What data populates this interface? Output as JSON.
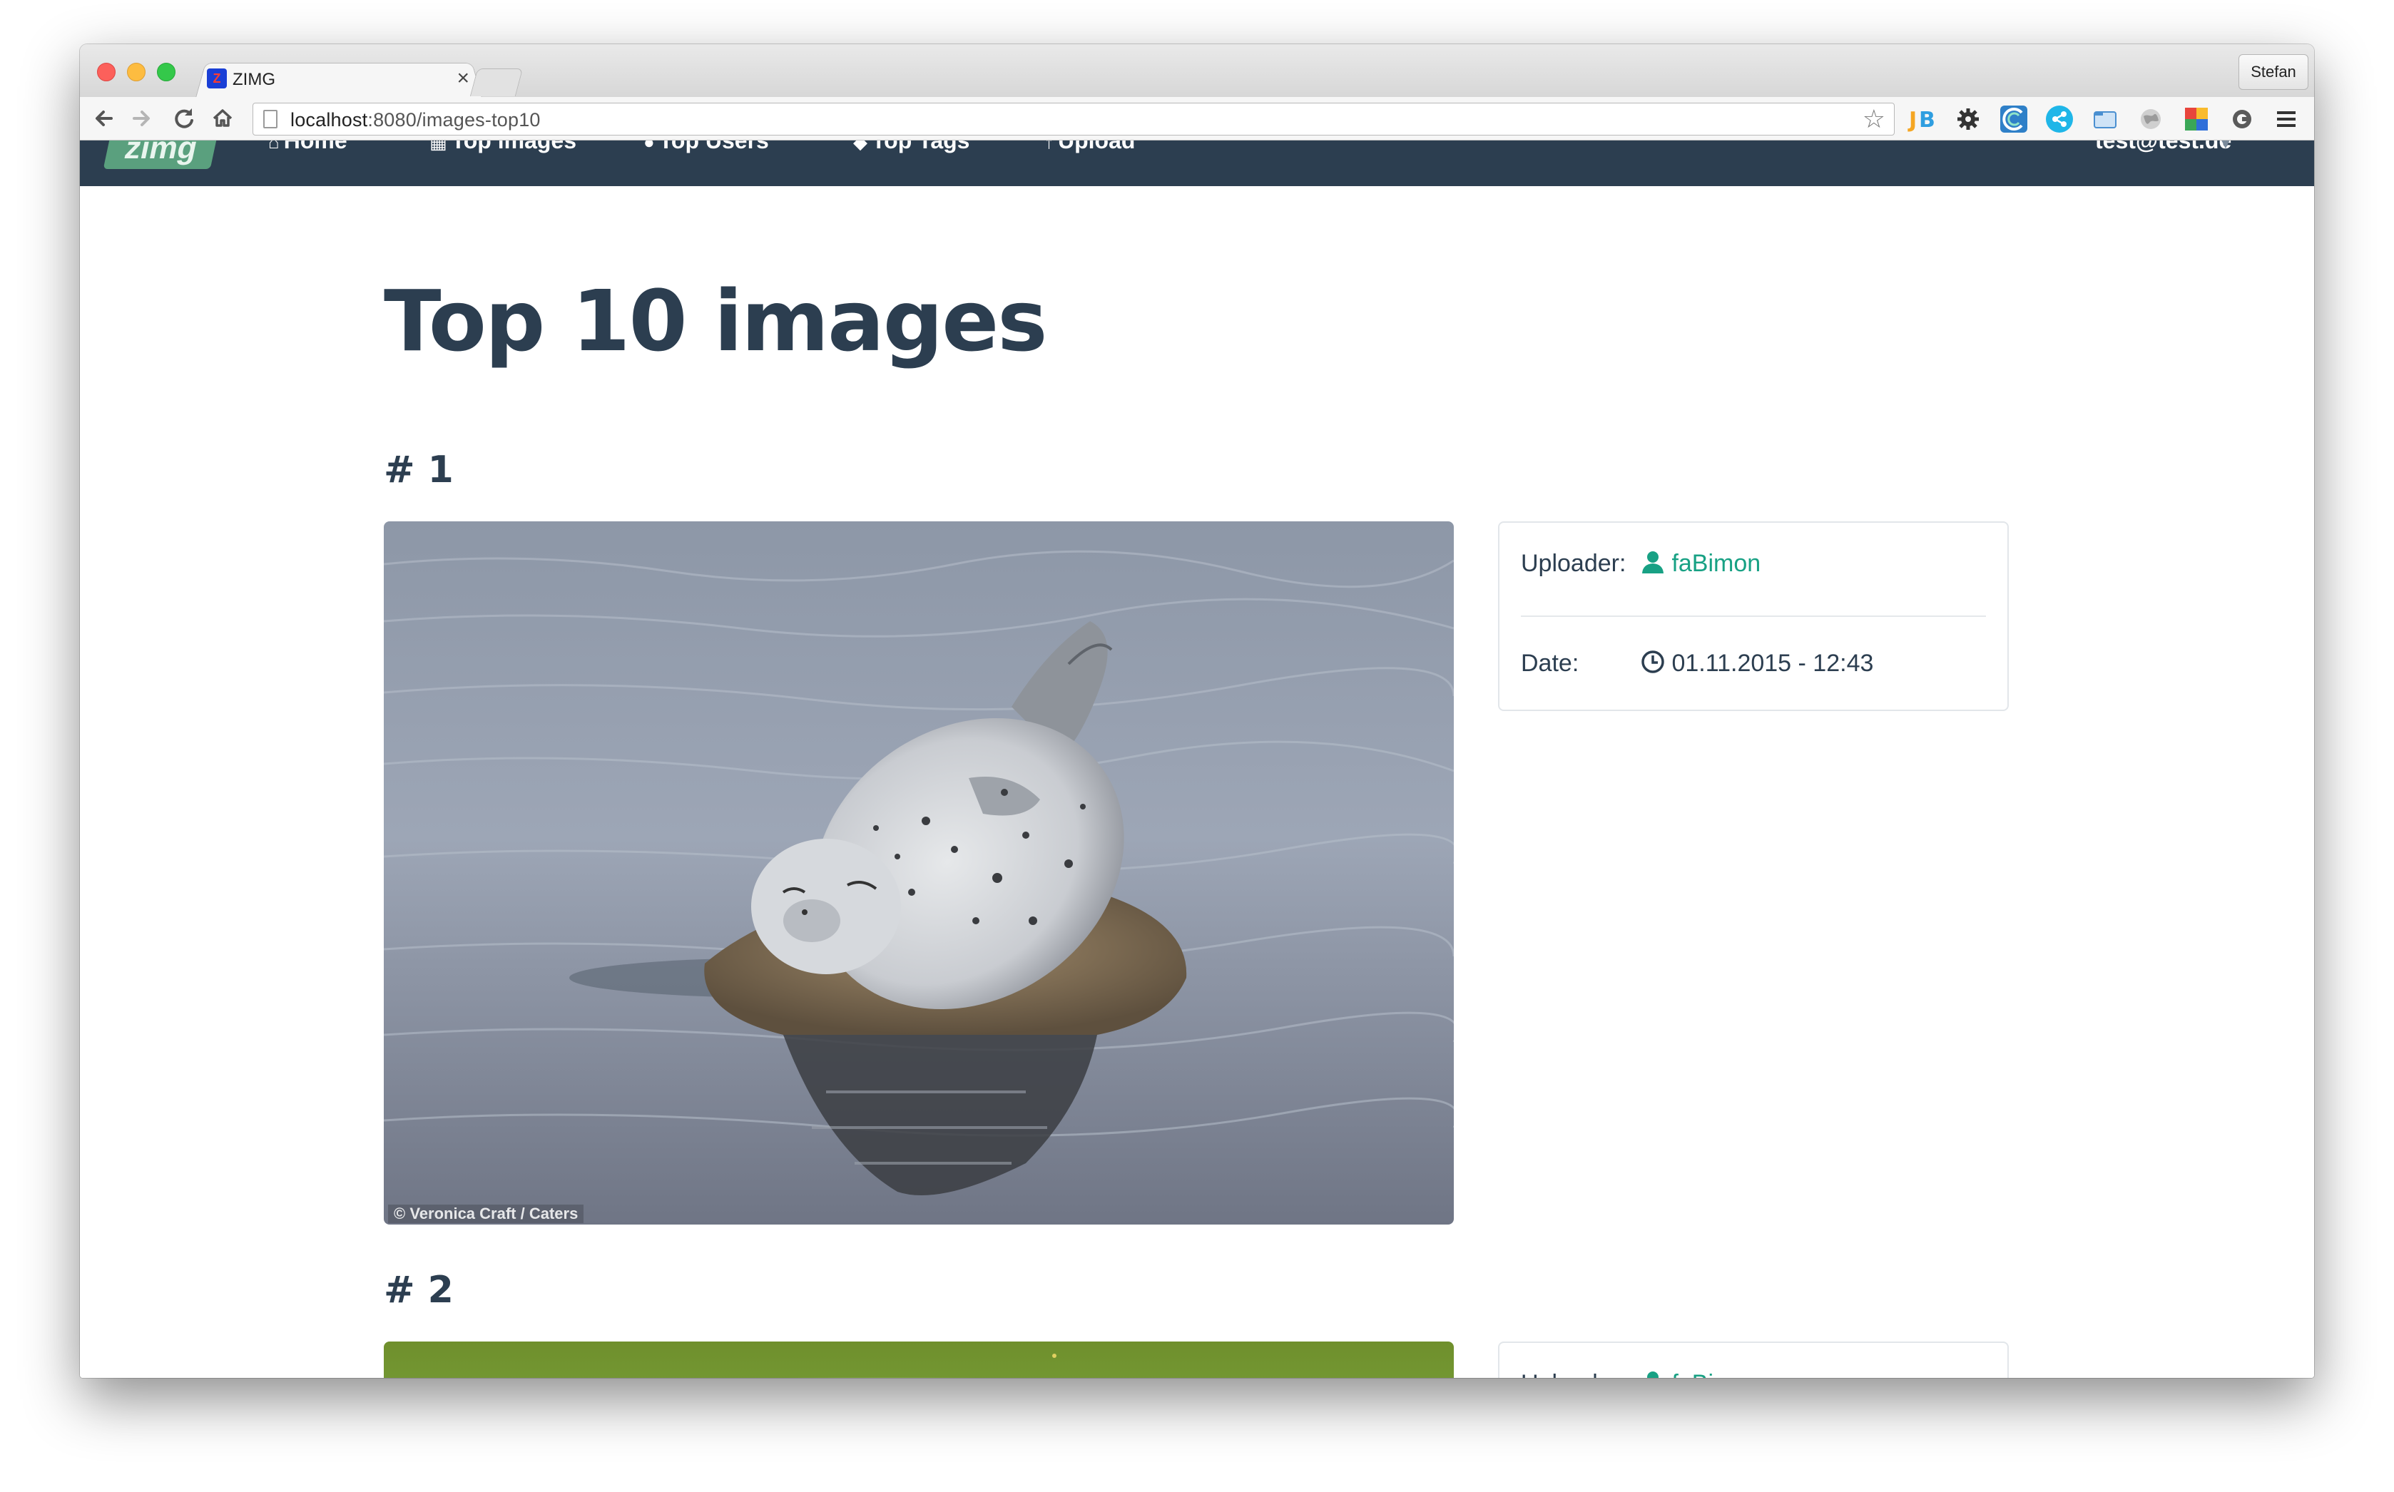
{
  "browser": {
    "tab_title": "ZIMG",
    "tab_favicon_glyph": "Z",
    "tab_close": "×",
    "profile_name": "Stefan",
    "url_host": "localhost",
    "url_path": ":8080/images-top10",
    "icons": [
      "back-arrow-icon",
      "forward-arrow-icon",
      "reload-icon",
      "home-icon",
      "page-icon",
      "star-icon",
      "jetbrains-icon",
      "gear-icon",
      "extension-icon",
      "share-icon",
      "folder-icon",
      "globe-icon",
      "color-grid-icon",
      "ghost-icon",
      "menu-icon"
    ]
  },
  "navbar": {
    "logo": "zimg",
    "links": [
      {
        "label": "Home",
        "icon": "home-icon"
      },
      {
        "label": "Top images",
        "icon": "image-icon"
      },
      {
        "label": "Top Users",
        "icon": "user-icon"
      },
      {
        "label": "Top Tags",
        "icon": "tag-icon"
      },
      {
        "label": "Upload",
        "icon": "upload-icon"
      }
    ],
    "user": "test@test.de"
  },
  "page": {
    "title": "Top 10 images",
    "entries": [
      {
        "rank": "# 1",
        "image_caption": "© Veronica Craft / Caters",
        "uploader_label": "Uploader:",
        "uploader": "faBimon",
        "date_label": "Date:",
        "date": "01.11.2015 - 12:43"
      },
      {
        "rank": "# 2",
        "uploader_label": "Uploader:",
        "uploader": "faBimon"
      }
    ]
  },
  "colors": {
    "navbar_bg": "#2c3e50",
    "heading": "#2c3e50",
    "link_teal": "#18a184"
  }
}
